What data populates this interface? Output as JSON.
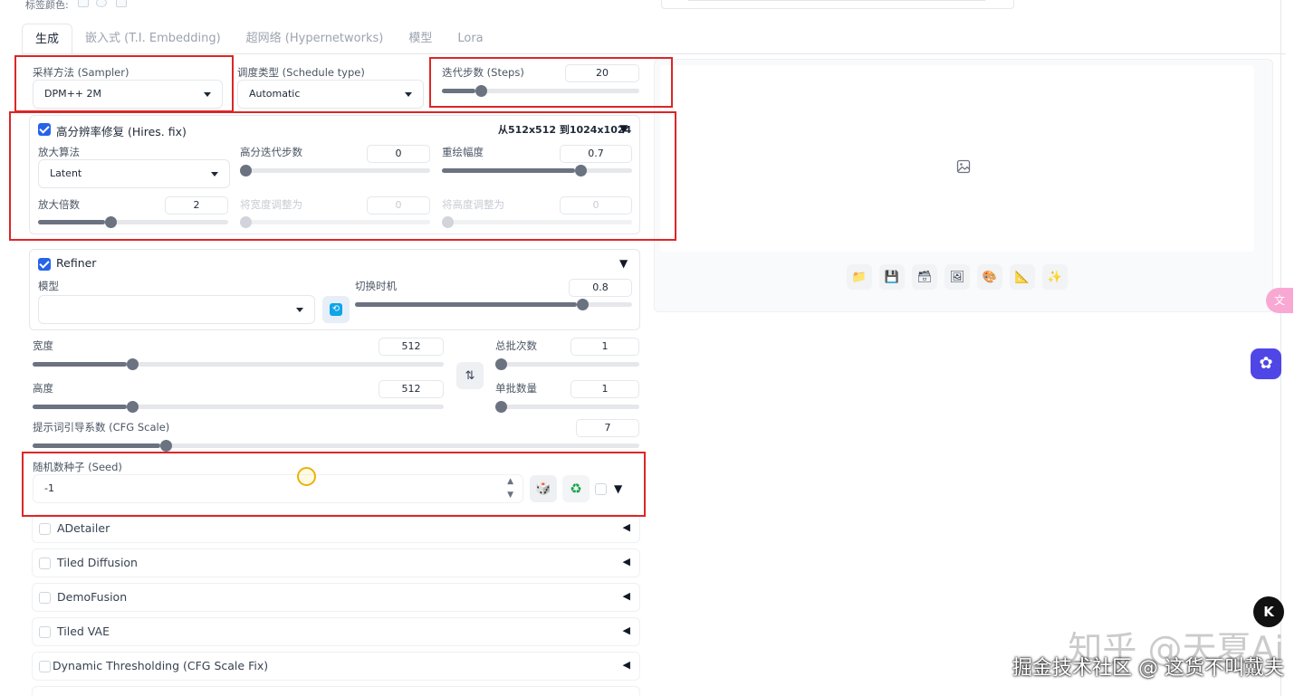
{
  "top": {
    "label": "标签颜色:"
  },
  "tabs": [
    "生成",
    "嵌入式 (T.I. Embedding)",
    "超网络 (Hypernetworks)",
    "模型",
    "Lora"
  ],
  "sampler": {
    "label": "采样方法 (Sampler)",
    "value": "DPM++ 2M"
  },
  "schedule": {
    "label": "调度类型 (Schedule type)",
    "value": "Automatic"
  },
  "steps": {
    "label": "迭代步数 (Steps)",
    "value": "20",
    "fraction": 0.17
  },
  "hires": {
    "title": "高分辨率修复 (Hires. fix)",
    "info": "从512x512 到1024x1024",
    "upscaler": {
      "label": "放大算法",
      "value": "Latent"
    },
    "hires_steps": {
      "label": "高分迭代步数",
      "value": "0",
      "fraction": 0.0
    },
    "denoise": {
      "label": "重绘幅度",
      "value": "0.7",
      "fraction": 0.7
    },
    "upscale_by": {
      "label": "放大倍数",
      "value": "2",
      "fraction": 0.35
    },
    "resize_w": {
      "label": "将宽度调整为",
      "value": "0",
      "fraction": 0.0
    },
    "resize_h": {
      "label": "将高度调整为",
      "value": "0",
      "fraction": 0.0
    }
  },
  "refiner": {
    "title": "Refiner",
    "model_label": "模型",
    "model_value": "",
    "switch": {
      "label": "切换时机",
      "value": "0.8",
      "fraction": 0.8
    }
  },
  "width": {
    "label": "宽度",
    "value": "512",
    "fraction": 0.23
  },
  "height": {
    "label": "高度",
    "value": "512",
    "fraction": 0.23
  },
  "batch_count": {
    "label": "总批次数",
    "value": "1",
    "fraction": 0.0
  },
  "batch_size": {
    "label": "单批数量",
    "value": "1",
    "fraction": 0.0
  },
  "cfg": {
    "label": "提示词引导系数 (CFG Scale)",
    "value": "7",
    "fraction": 0.21
  },
  "seed": {
    "label": "随机数种子 (Seed)",
    "value": "-1"
  },
  "accordions": [
    "ADetailer",
    "Tiled Diffusion",
    "DemoFusion",
    "Tiled VAE",
    "Dynamic Thresholding (CFG Scale Fix)"
  ],
  "icons": {
    "toolbar": [
      "folder-icon",
      "save-icon",
      "zip-icon",
      "image-icon",
      "palette-icon",
      "ruler-icon",
      "sparkle-icon"
    ],
    "swap": "swap-icon",
    "dice": "dice-icon",
    "recycle": "recycle-icon"
  },
  "watermark": {
    "line1": "知乎 @天夏Ai",
    "line2": "掘金技术社区 @ 这货不叫戴夫"
  },
  "colors": {
    "highlight": "#dc2626",
    "accent": "#2563eb",
    "track": "#6b7280"
  }
}
